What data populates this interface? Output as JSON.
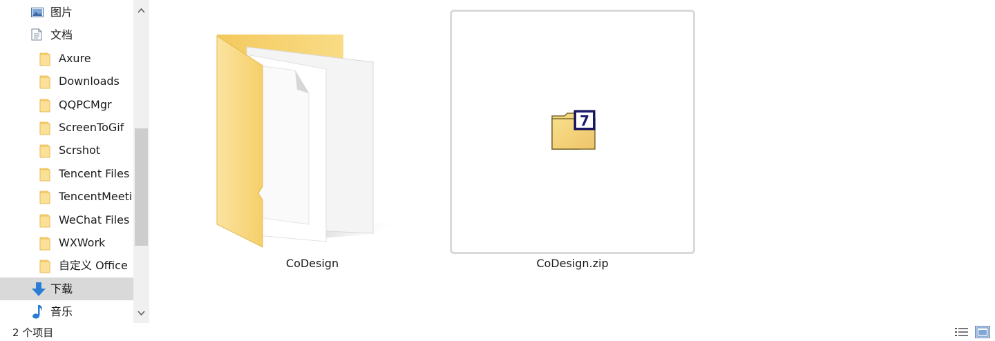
{
  "nav": {
    "items": [
      {
        "label": "图片",
        "icon": "pictures-icon",
        "level": 1,
        "selected": false
      },
      {
        "label": "文档",
        "icon": "documents-icon",
        "level": 1,
        "selected": false
      },
      {
        "label": "Axure",
        "icon": "folder-icon",
        "level": 2,
        "selected": false
      },
      {
        "label": "Downloads",
        "icon": "folder-icon",
        "level": 2,
        "selected": false
      },
      {
        "label": "QQPCMgr",
        "icon": "folder-icon",
        "level": 2,
        "selected": false
      },
      {
        "label": "ScreenToGif",
        "icon": "folder-icon",
        "level": 2,
        "selected": false
      },
      {
        "label": "Scrshot",
        "icon": "folder-icon",
        "level": 2,
        "selected": false
      },
      {
        "label": "Tencent Files",
        "icon": "folder-icon",
        "level": 2,
        "selected": false
      },
      {
        "label": "TencentMeeti",
        "icon": "folder-icon",
        "level": 2,
        "selected": false
      },
      {
        "label": "WeChat Files",
        "icon": "folder-icon",
        "level": 2,
        "selected": false
      },
      {
        "label": "WXWork",
        "icon": "folder-icon",
        "level": 2,
        "selected": false
      },
      {
        "label": "自定义 Office",
        "icon": "folder-icon",
        "level": 2,
        "selected": false
      },
      {
        "label": "下载",
        "icon": "download-arrow-icon",
        "level": 1,
        "selected": true
      },
      {
        "label": "音乐",
        "icon": "music-note-icon",
        "level": 1,
        "selected": false
      }
    ]
  },
  "content": {
    "files": [
      {
        "name": "CoDesign",
        "type": "folder",
        "icon": "large-folder-icon"
      },
      {
        "name": "CoDesign.zip",
        "type": "archive",
        "icon": "7zip-archive-icon"
      }
    ]
  },
  "status": {
    "item_count": "2 个项目"
  },
  "colors": {
    "selected_bg": "#d9d9d9",
    "folder_yellow": "#f8d775",
    "accent_blue": "#2b7cd3"
  }
}
